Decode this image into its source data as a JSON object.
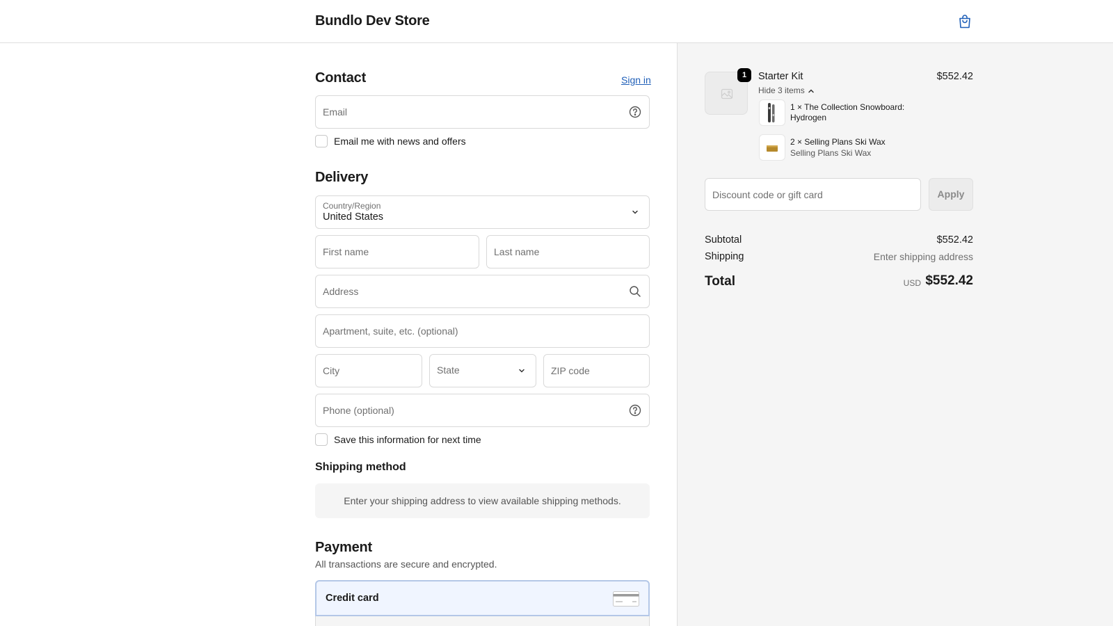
{
  "header": {
    "store_name": "Bundlo Dev Store",
    "cart_icon": "shopping-bag-icon"
  },
  "contact": {
    "title": "Contact",
    "sign_in": "Sign in",
    "email_placeholder": "Email",
    "email_news_label": "Email me with news and offers",
    "email_news_checked": false
  },
  "delivery": {
    "title": "Delivery",
    "country_label": "Country/Region",
    "country_value": "United States",
    "first_name_placeholder": "First name",
    "last_name_placeholder": "Last name",
    "address_placeholder": "Address",
    "apartment_placeholder": "Apartment, suite, etc. (optional)",
    "city_placeholder": "City",
    "state_placeholder": "State",
    "zip_placeholder": "ZIP code",
    "phone_placeholder": "Phone (optional)",
    "save_info_label": "Save this information for next time",
    "save_info_checked": false
  },
  "shipping": {
    "title": "Shipping method",
    "message": "Enter your shipping address to view available shipping methods."
  },
  "payment": {
    "title": "Payment",
    "note": "All transactions are secure and encrypted.",
    "method_label": "Credit card"
  },
  "order": {
    "product": {
      "quantity": "1",
      "name": "Starter Kit",
      "price": "$552.42",
      "toggle_label": "Hide 3 items"
    },
    "bundle_items": [
      {
        "line1": "1 × The Collection Snowboard: Hydrogen",
        "line2": ""
      },
      {
        "line1": "2 × Selling Plans Ski Wax",
        "line2": "Selling Plans Ski Wax"
      }
    ],
    "discount_placeholder": "Discount code or gift card",
    "apply_label": "Apply",
    "subtotal_label": "Subtotal",
    "subtotal_value": "$552.42",
    "shipping_label": "Shipping",
    "shipping_value": "Enter shipping address",
    "total_label": "Total",
    "total_currency": "USD",
    "total_value": "$552.42"
  },
  "colors": {
    "link": "#1f5fb8",
    "panel_bg": "#f5f5f5",
    "border": "#d9d9d9"
  }
}
